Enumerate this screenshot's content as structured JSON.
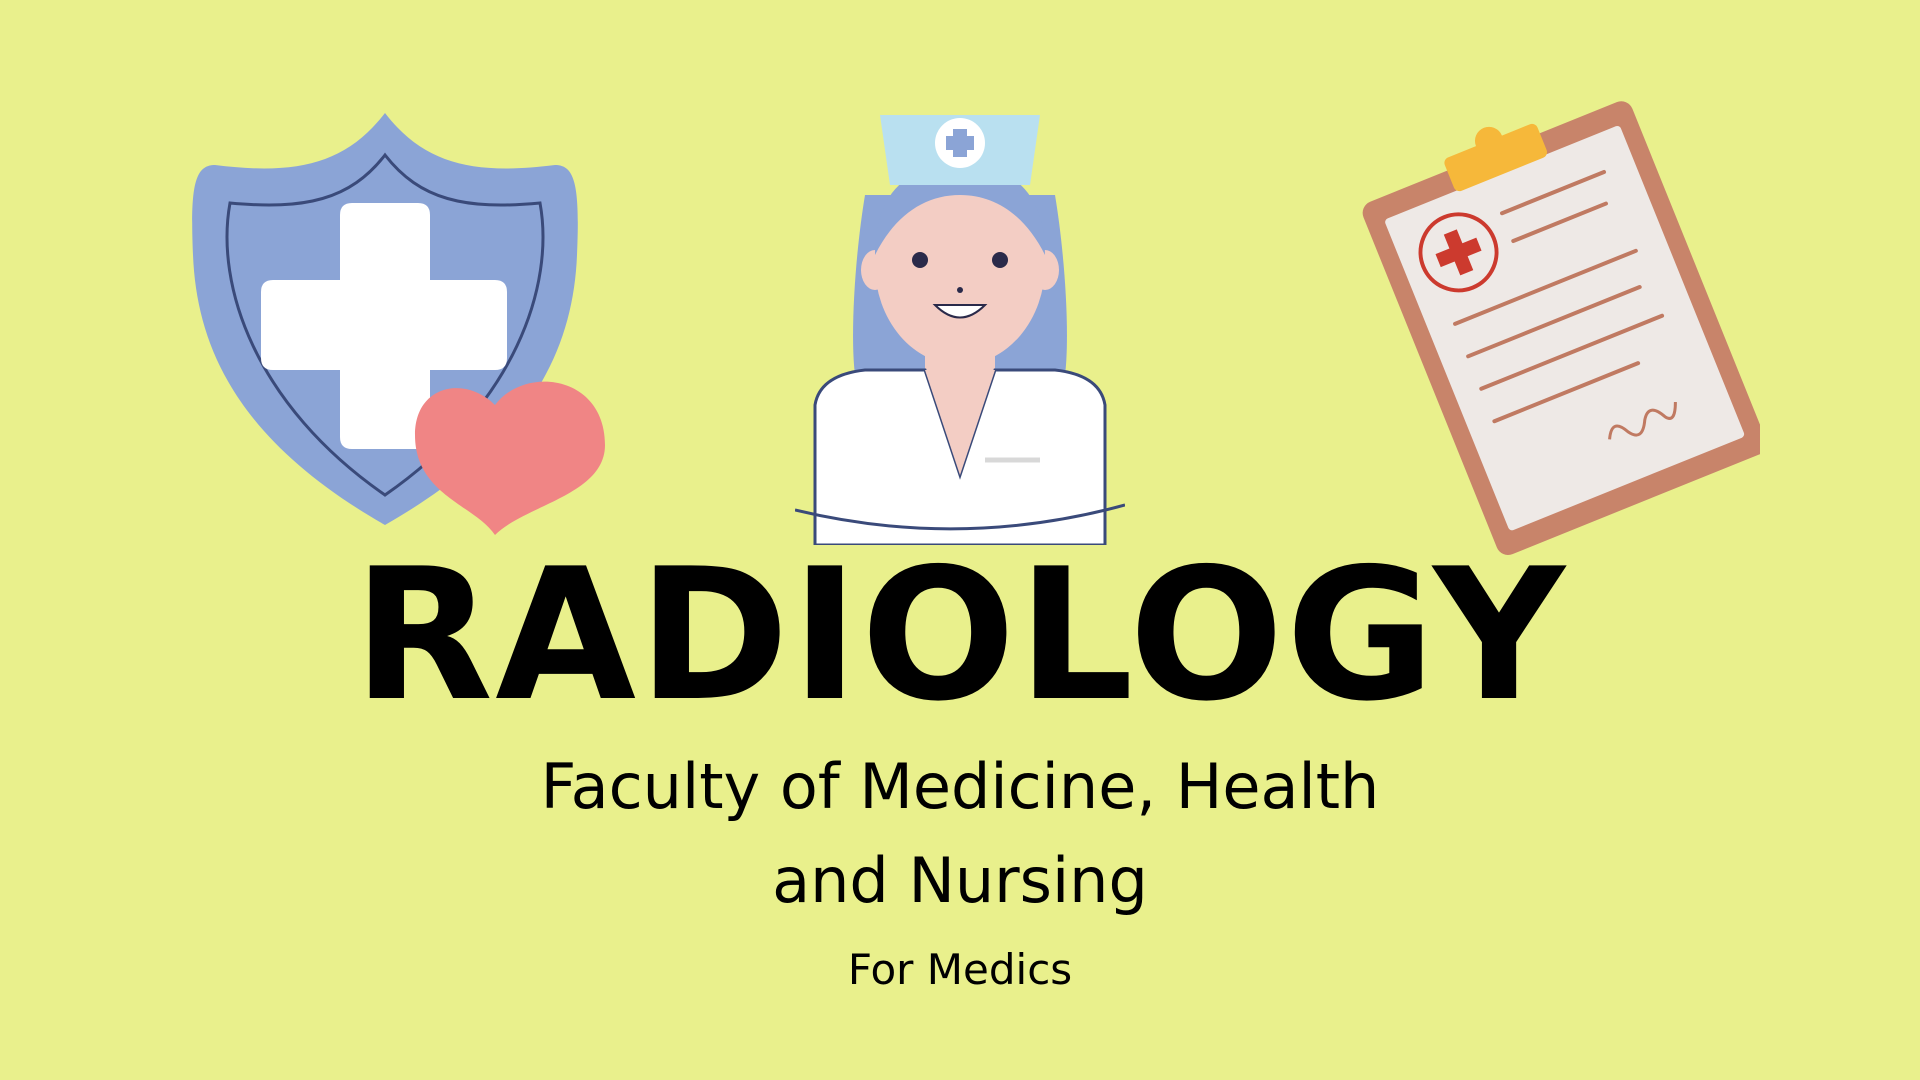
{
  "background_color": "#e9f08c",
  "illustrations": [
    {
      "name": "shield-with-medical-cross-icon"
    },
    {
      "name": "heart-icon"
    },
    {
      "name": "nurse-icon"
    },
    {
      "name": "medical-clipboard-icon"
    }
  ],
  "title": "RADIOLOGY",
  "subtitle": {
    "line1": "Faculty of Medicine, Health",
    "line2": "and Nursing"
  },
  "tagline": "For Medics",
  "colors": {
    "shield": "#8ba4d6",
    "heart": "#f08585",
    "clipboard_board": "#c8846a",
    "clip": "#f6b83a",
    "medical_red": "#cc3a2e",
    "text": "#000000"
  }
}
